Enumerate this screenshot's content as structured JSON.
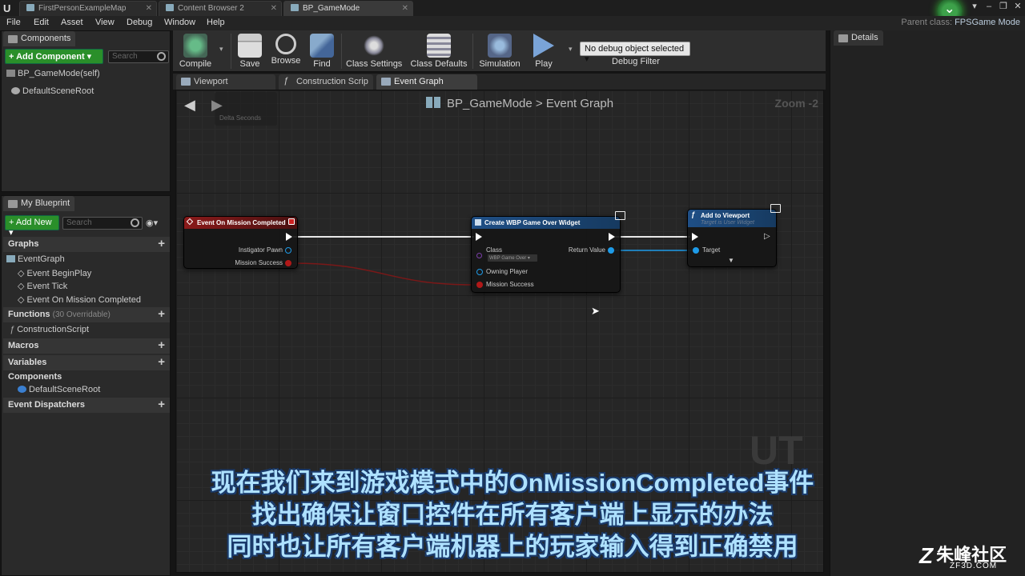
{
  "tabs": [
    {
      "label": "FirstPersonExampleMap"
    },
    {
      "label": "Content Browser 2"
    },
    {
      "label": "BP_GameMode"
    }
  ],
  "menu": [
    "File",
    "Edit",
    "Asset",
    "View",
    "Debug",
    "Window",
    "Help"
  ],
  "parent_class": {
    "label": "Parent class:",
    "value": "FPSGame Mode"
  },
  "components_panel": {
    "tab": "Components",
    "add_button": "+ Add Component ▾",
    "search_placeholder": "Search",
    "items": [
      "BP_GameMode(self)",
      "DefaultSceneRoot"
    ]
  },
  "blueprint_panel": {
    "tab": "My Blueprint",
    "add_button": "+ Add New ▾",
    "search_placeholder": "Search",
    "graphs_header": "Graphs",
    "graphs": [
      "EventGraph",
      "Event BeginPlay",
      "Event Tick",
      "Event On Mission Completed"
    ],
    "functions_header": "Functions",
    "functions_sub": "(30 Overridable)",
    "functions": [
      "ConstructionScript"
    ],
    "macros_header": "Macros",
    "variables_header": "Variables",
    "components_header": "Components",
    "components": [
      "DefaultSceneRoot"
    ],
    "dispatchers_header": "Event Dispatchers"
  },
  "toolbar": {
    "compile": "Compile",
    "save": "Save",
    "browse": "Browse",
    "find": "Find",
    "class_settings": "Class Settings",
    "class_defaults": "Class Defaults",
    "simulation": "Simulation",
    "play": "Play",
    "debug_object": "No debug object selected ▾",
    "debug_filter": "Debug Filter"
  },
  "editor_tabs": [
    "Viewport",
    "Construction Scrip",
    "Event Graph"
  ],
  "graph": {
    "breadcrumb_root": "BP_GameMode",
    "breadcrumb_sep": ">",
    "breadcrumb_leaf": "Event Graph",
    "zoom": "Zoom -2",
    "ghost_node_label": "Delta Seconds",
    "event_node": {
      "title": "Event On Mission Completed",
      "pins": [
        "Instigator Pawn",
        "Mission Success"
      ]
    },
    "create_node": {
      "title": "Create WBP Game Over Widget",
      "class_label": "Class",
      "class_value": "WBP Game Over ▾",
      "owning_player": "Owning Player",
      "mission_success": "Mission Success",
      "return_value": "Return Value"
    },
    "viewport_node": {
      "title": "Add to Viewport",
      "subtitle": "Target is User Widget",
      "target": "Target"
    },
    "watermark": "UT"
  },
  "details_panel": {
    "tab": "Details"
  },
  "subtitles": [
    "现在我们来到游戏模式中的OnMissionCompleted事件",
    "找出确保让窗口控件在所有客户端上显示的办法",
    "同时也让所有客户端机器上的玩家输入得到正确禁用"
  ],
  "brand": {
    "name": "朱峰社区",
    "url": "ZF3D.COM"
  },
  "colors": {
    "accent_green": "#2a8f2a",
    "event_header": "#8a1a1a",
    "function_header": "#1f4f86",
    "object_pin": "#1e9be8",
    "bool_pin": "#b01818",
    "subtitle_text": "#aee1ff"
  }
}
